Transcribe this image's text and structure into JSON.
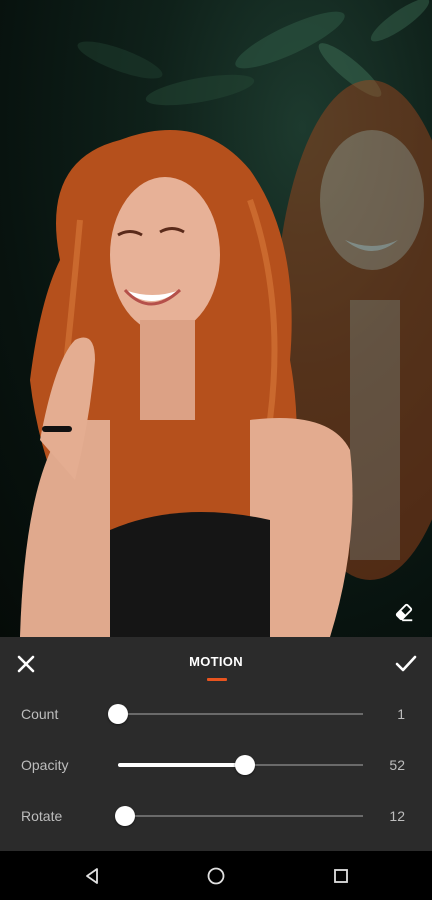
{
  "editor": {
    "title": "MOTION",
    "accent_color": "#e8541f"
  },
  "sliders": [
    {
      "label": "Count",
      "value": "1",
      "level": 0.0
    },
    {
      "label": "Opacity",
      "value": "52",
      "level": 0.52
    },
    {
      "label": "Rotate",
      "value": "12",
      "level": 0.03
    }
  ],
  "icons": {
    "close": "close-icon",
    "confirm": "checkmark-icon",
    "eraser": "eraser-icon",
    "nav_back": "back-triangle-icon",
    "nav_home": "home-circle-icon",
    "nav_recents": "recents-square-icon"
  }
}
